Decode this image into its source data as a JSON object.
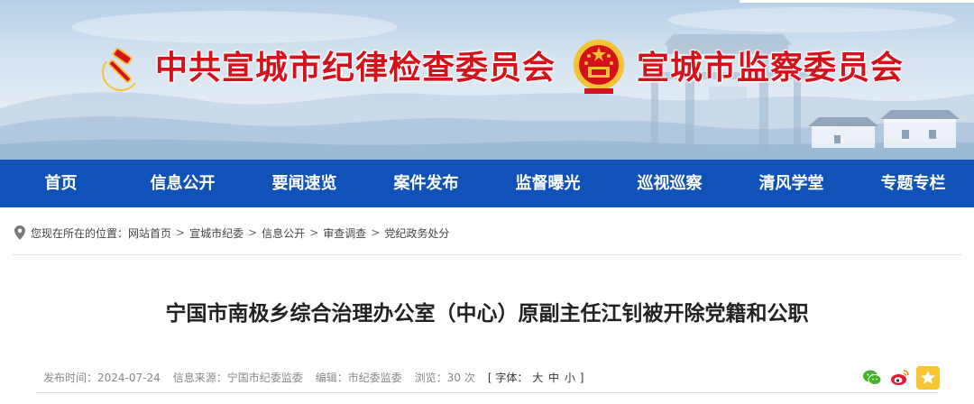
{
  "banner": {
    "title_left": "中共宣城市纪律检查委员会",
    "title_right": "宣城市监察委员会",
    "brand_red": "#d4121c",
    "party_emblem_icon": "party-emblem-icon",
    "state_emblem_icon": "national-emblem-icon"
  },
  "nav": {
    "background": "#1052b7",
    "items": [
      {
        "label": "首页"
      },
      {
        "label": "信息公开"
      },
      {
        "label": "要闻速览"
      },
      {
        "label": "案件发布"
      },
      {
        "label": "监督曝光"
      },
      {
        "label": "巡视巡察"
      },
      {
        "label": "清风学堂"
      },
      {
        "label": "专题专栏"
      }
    ]
  },
  "breadcrumb": {
    "prefix": "您现在所在的位置：",
    "separator": ">",
    "items": [
      {
        "label": "网站首页"
      },
      {
        "label": "宣城市纪委"
      },
      {
        "label": "信息公开"
      },
      {
        "label": "审查调查"
      },
      {
        "label": "党纪政务处分"
      }
    ]
  },
  "article": {
    "title": "宁国市南极乡综合治理办公室（中心）原副主任江钊被开除党籍和公职",
    "publish_time": "发布时间：2024-07-24",
    "source": "信息来源：宁国市纪委监委",
    "editor": "编辑：市纪委监委",
    "views": "浏览：30 次",
    "font_size": {
      "open": "[ 字体：",
      "large": "大",
      "medium": "中",
      "small": "小",
      "close": "]"
    }
  },
  "share": {
    "wechat_icon": "wechat-icon",
    "weibo_icon": "weibo-icon",
    "favorite_icon": "star-icon",
    "wechat_color": "#46b12b",
    "weibo_color": "#e6162d",
    "favorite_color": "#f7c634"
  }
}
